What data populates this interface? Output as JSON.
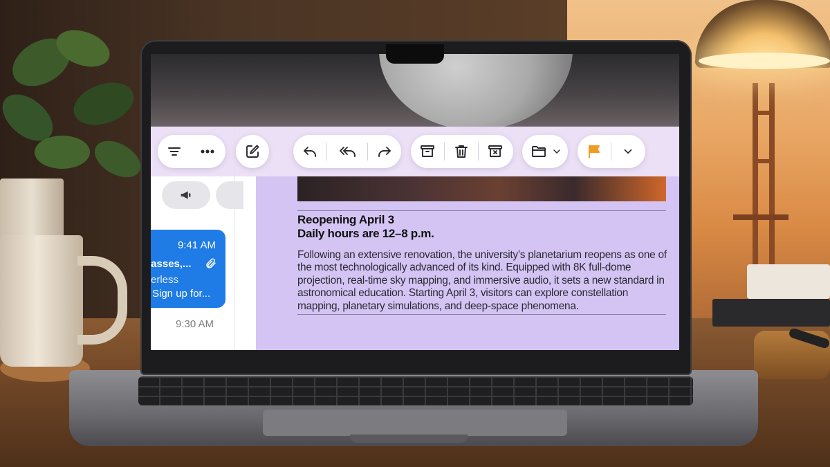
{
  "colors": {
    "accent": "#1f7be5",
    "flag": "#f29b22",
    "content_bg": "#d3c4f4",
    "toolbar_band": "#ebdef5"
  },
  "sidebar": {
    "icons": [
      "filter-lines-icon",
      "more-dots-icon",
      "megaphone-icon"
    ],
    "selected_message": {
      "time": "9:41 AM",
      "subject": "lasses,...",
      "line1": "erless",
      "line2": "Sign up for..."
    },
    "next_message_time": "9:30 AM"
  },
  "toolbar": {
    "icons": [
      "compose-icon",
      "reply-icon",
      "reply-all-icon",
      "forward-icon",
      "archive-icon",
      "trash-icon",
      "junk-icon",
      "move-to-folder-icon",
      "flag-icon",
      "chevron-down-icon"
    ]
  },
  "message": {
    "heading_line1": "Reopening April 3",
    "heading_line2": "Daily hours are 12–8 p.m.",
    "body": "Following an extensive renovation, the university’s planetarium reopens as one of the most technologically advanced of its kind. Equipped with 8K full-dome projection, real-time sky mapping, and immersive audio, it sets a new standard in astronomical education. Starting April 3, visitors can explore constellation mapping, planetary simulations, and deep-space phenomena."
  }
}
